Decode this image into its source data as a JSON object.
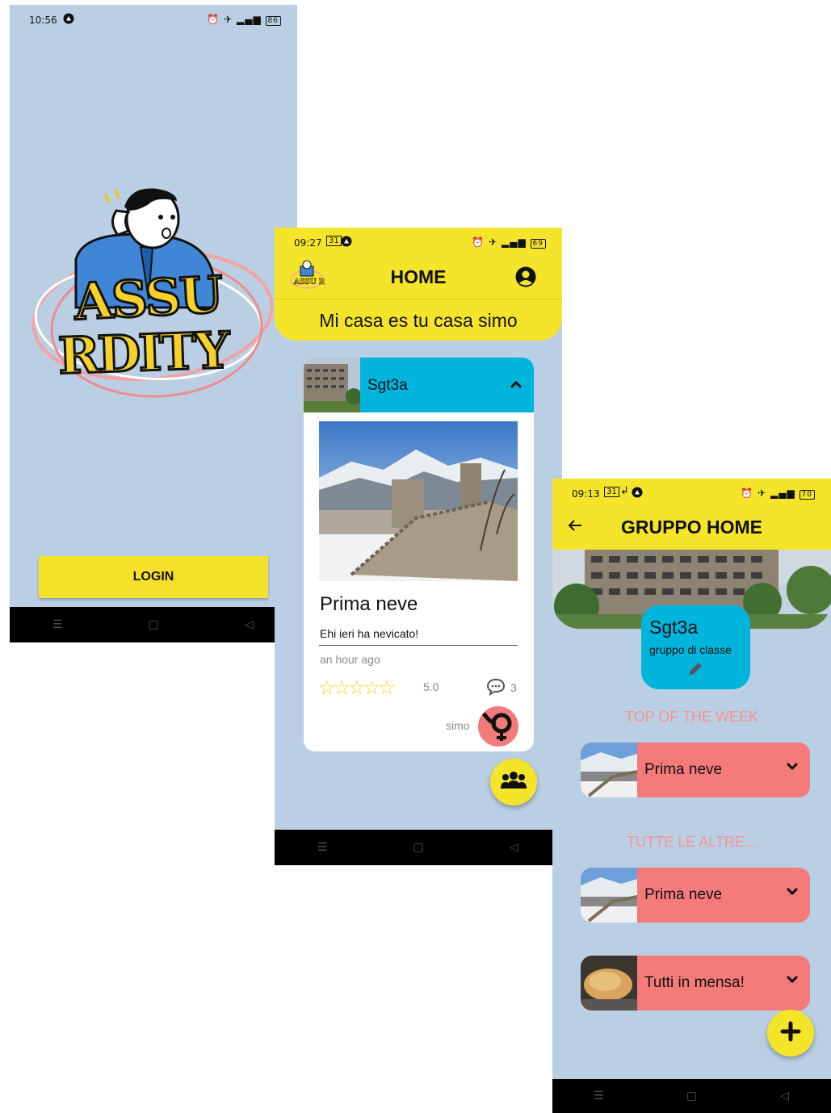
{
  "login_screen": {
    "status_time": "10:56",
    "battery": "86",
    "logo_line1": "ASSU",
    "logo_line2": "RDITY",
    "login_label": "LOGIN"
  },
  "home_screen": {
    "status_time": "09:27",
    "battery": "69",
    "title": "HOME",
    "subtitle": "Mi casa es tu casa simo",
    "logo_text": "ASSU RDITY",
    "group_name": "Sgt3a",
    "post": {
      "title": "Prima neve",
      "body": "Ehi ieri ha nevicato!",
      "time": "an hour ago",
      "rating": "5.0",
      "comments": "3",
      "author": "simo"
    }
  },
  "group_screen": {
    "status_time": "09:13",
    "battery": "70",
    "title": "GRUPPO HOME",
    "group_name": "Sgt3a",
    "group_desc": "gruppo di classe",
    "top_section": "TOP OF THE WEEK",
    "others_section": "TUTTE LE ALTRE...",
    "top_items": [
      {
        "label": "Prima neve"
      }
    ],
    "other_items": [
      {
        "label": "Prima neve"
      },
      {
        "label": "Tutti in mensa!"
      }
    ]
  },
  "colors": {
    "bg": "#bacfe3",
    "yellow": "#f5e52a",
    "cyan": "#00b4dc",
    "coral": "#f57a7a"
  }
}
